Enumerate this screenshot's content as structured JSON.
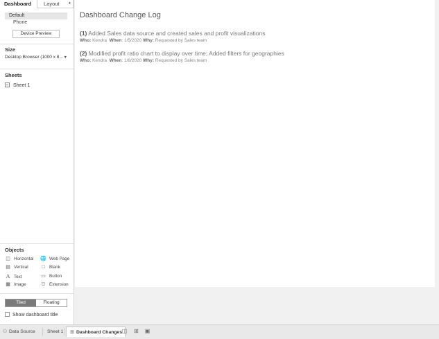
{
  "panel": {
    "tab_dashboard": "Dashboard",
    "tab_layout": "Layout",
    "device_default": "Default",
    "device_phone": "Phone",
    "device_preview_button": "Device Preview",
    "size_title": "Size",
    "size_value": "Desktop Browser (1000 x 8...",
    "sheets_title": "Sheets",
    "sheets": [
      "Sheet 1"
    ],
    "objects_title": "Objects",
    "objects": [
      {
        "label": "Horizontal",
        "icon": "horizontal-container-icon"
      },
      {
        "label": "Web Page",
        "icon": "globe-icon"
      },
      {
        "label": "Vertical",
        "icon": "vertical-container-icon"
      },
      {
        "label": "Blank",
        "icon": "blank-icon"
      },
      {
        "label": "Text",
        "icon": "text-icon"
      },
      {
        "label": "Button",
        "icon": "button-icon"
      },
      {
        "label": "Image",
        "icon": "image-icon"
      },
      {
        "label": "Extension",
        "icon": "extension-icon"
      }
    ],
    "tiled_label": "Tiled",
    "floating_label": "Floating",
    "show_title_label": "Show dashboard title",
    "show_title_checked": false
  },
  "canvas": {
    "title": "Dashboard Change Log",
    "entries": [
      {
        "num": "(1)",
        "text": "Added Sales data source and created sales and profit visualizations",
        "who_label": "Who:",
        "who": "Kendra",
        "when_label": "When",
        "when": ": 1/5/2020",
        "why_label": "Why:",
        "why": "Requested by Sales team"
      },
      {
        "num": "(2)",
        "text": "Modified profit ratio chart to display over time; Added filters for geographies",
        "who_label": "Who:",
        "who": "Kendra",
        "when_label": "When",
        "when": ": 1/8/2020",
        "why_label": "Why:",
        "why": "Requested by Sales team"
      }
    ]
  },
  "bottom_tabs": {
    "data_source": "Data Source",
    "sheet1": "Sheet 1",
    "dashboard_changes": "Dashboard Changes"
  },
  "colors": {
    "active_toggle": "#7a7a7a",
    "selected_device_bg": "#e6e6e6"
  }
}
